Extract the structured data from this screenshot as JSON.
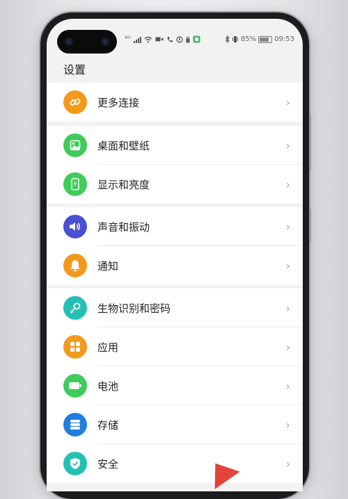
{
  "statusbar": {
    "signal_label": "⁴ᴳ",
    "battery_percent": "85%",
    "time": "09:53"
  },
  "page": {
    "title": "设置"
  },
  "groups": [
    {
      "items": [
        {
          "label": "更多连接",
          "icon": "link-icon",
          "color": "#f39a1c"
        }
      ]
    },
    {
      "items": [
        {
          "label": "桌面和壁纸",
          "icon": "wallpaper-icon",
          "color": "#3fcc5a"
        },
        {
          "label": "显示和亮度",
          "icon": "display-icon",
          "color": "#3fcc5a"
        }
      ]
    },
    {
      "items": [
        {
          "label": "声音和振动",
          "icon": "sound-icon",
          "color": "#4a4fd4"
        },
        {
          "label": "通知",
          "icon": "bell-icon",
          "color": "#f39a1c"
        }
      ]
    },
    {
      "items": [
        {
          "label": "生物识别和密码",
          "icon": "key-icon",
          "color": "#24c0b6"
        },
        {
          "label": "应用",
          "icon": "apps-icon",
          "color": "#f39a1c"
        },
        {
          "label": "电池",
          "icon": "battery-icon",
          "color": "#3fcc5a"
        },
        {
          "label": "存储",
          "icon": "storage-icon",
          "color": "#1f7ee0"
        },
        {
          "label": "安全",
          "icon": "shield-icon",
          "color": "#24c0b6"
        }
      ]
    }
  ],
  "chevron": "›"
}
